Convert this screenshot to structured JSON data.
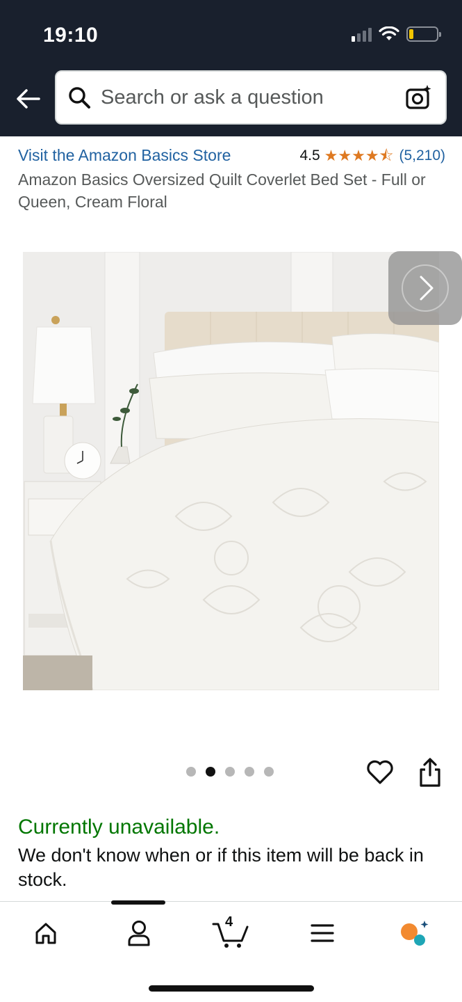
{
  "status_bar": {
    "time": "19:10"
  },
  "search": {
    "placeholder": "Search or ask a question"
  },
  "product": {
    "store_link": "Visit the Amazon Basics Store",
    "rating_value": "4.5",
    "rating_stars": 4.5,
    "rating_count": "(5,210)",
    "title": "Amazon Basics Oversized Quilt Coverlet Bed Set - Full or Queen, Cream Floral",
    "image_alt": "product-photo-bed-with-cream-floral-quilt"
  },
  "carousel": {
    "total": 5,
    "current": 2
  },
  "availability": {
    "status": "Currently unavailable.",
    "note": "We don't know when or if this item will be back in stock."
  },
  "bottom_nav": {
    "items": [
      "home",
      "account",
      "cart",
      "menu",
      "rufus"
    ],
    "active": "account",
    "cart_count": "4"
  },
  "colors": {
    "header_bg": "#19202d",
    "link": "#2162a1",
    "star": "#de7921",
    "available_green": "#007600"
  }
}
